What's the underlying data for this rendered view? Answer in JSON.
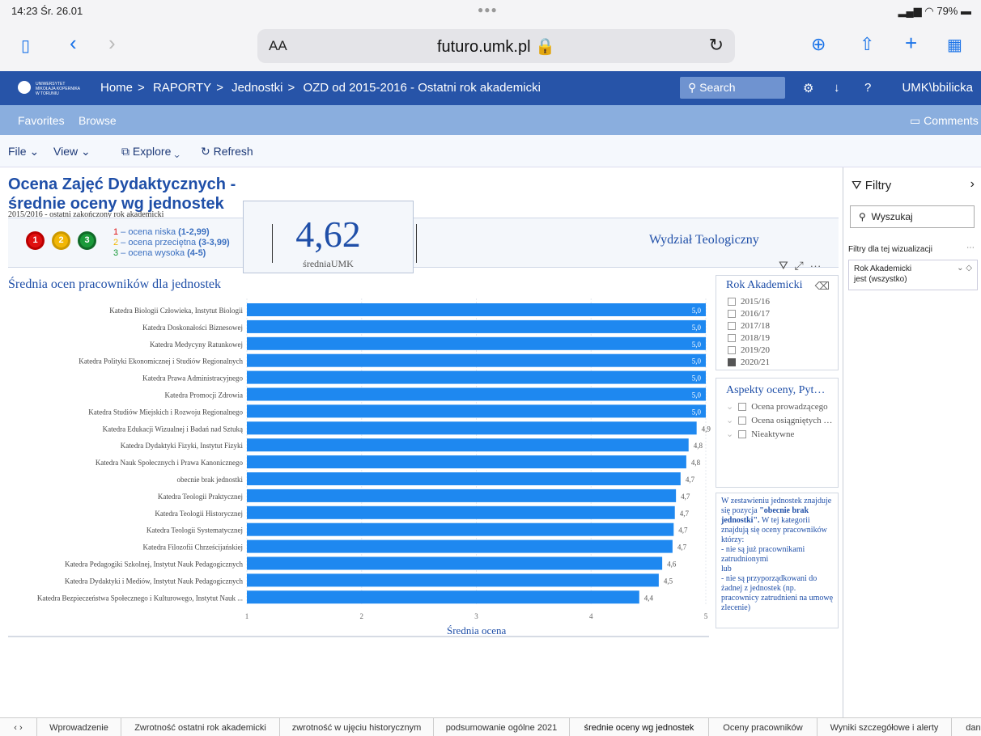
{
  "statusbar": {
    "time": "14:23  Śr. 26.01",
    "battery": "79%"
  },
  "safari": {
    "url": "futuro.umk.pl",
    "aa": "AA"
  },
  "header": {
    "logo_text": "UNIWERSYTET MIKOŁAJA KOPERNIKA W TORUNIU",
    "breadcrumb": [
      "Home",
      "RAPORTY",
      "Jednostki",
      "OZD od 2015-2016 - Ostatni rok akademicki"
    ],
    "search_label": "Search",
    "help": "?",
    "user": "UMK\\bbilicka"
  },
  "nav": {
    "favorites": "Favorites",
    "browse": "Browse",
    "comments": "Comments"
  },
  "toolbar": {
    "file": "File",
    "view": "View",
    "explore": "Explore",
    "refresh": "Refresh"
  },
  "report": {
    "title_line1": "Ocena Zajęć Dydaktycznych -",
    "title_line2": "średnie oceny wg jednostek",
    "subtitle": "2015/2016 - ostatni zakończony rok akademicki",
    "legend": [
      {
        "num": "1",
        "text": " – ocena niska ",
        "range": "(1-2,99)",
        "color": "#e01010"
      },
      {
        "num": "2",
        "text": " – ocena przeciętna ",
        "range": "(3-3,99)",
        "color": "#f2b705"
      },
      {
        "num": "3",
        "text": " – ocena wysoka ",
        "range": "(4-5)",
        "color": "#1a9a3a"
      }
    ],
    "kpi_value": "4,62",
    "kpi_label": "średniaUMK",
    "faculty": "Wydział Teologiczny"
  },
  "chart_data": {
    "type": "bar",
    "orientation": "horizontal",
    "title": "Średnia ocen pracowników dla jednostek",
    "xlabel": "Średnia ocena",
    "xlim": [
      1,
      5
    ],
    "xticks": [
      "1",
      "2",
      "3",
      "4",
      "5"
    ],
    "categories": [
      "Katedra Biologii Człowieka, Instytut Biologii",
      "Katedra Doskonałości Biznesowej",
      "Katedra Medycyny Ratunkowej",
      "Katedra Polityki Ekonomicznej i Studiów Regionalnych",
      "Katedra Prawa Administracyjnego",
      "Katedra Promocji Zdrowia",
      "Katedra Studiów Miejskich i Rozwoju Regionalnego",
      "Katedra Edukacji Wizualnej i Badań nad Sztuką",
      "Katedra Dydaktyki Fizyki, Instytut Fizyki",
      "Katedra Nauk Społecznych i Prawa Kanonicznego",
      "obecnie brak jednostki",
      "Katedra Teologii Praktycznej",
      "Katedra Teologii Historycznej",
      "Katedra Teologii Systematycznej",
      "Katedra Filozofii Chrześcijańskiej",
      "Katedra Pedagogiki Szkolnej, Instytut Nauk Pedagogicznych",
      "Katedra Dydaktyki i Mediów, Instytut Nauk Pedagogicznych",
      "Katedra Bezpieczeństwa Społecznego i Kulturowego, Instytut Nauk ..."
    ],
    "values": [
      5.0,
      5.0,
      5.0,
      5.0,
      5.0,
      5.0,
      5.0,
      4.92,
      4.85,
      4.83,
      4.78,
      4.74,
      4.73,
      4.72,
      4.71,
      4.62,
      4.59,
      4.42
    ],
    "value_labels": [
      "5,0",
      "5,0",
      "5,0",
      "5,0",
      "5,0",
      "5,0",
      "5,0",
      "4,9",
      "4,8",
      "4,8",
      "4,7",
      "4,7",
      "4,7",
      "4,7",
      "4,7",
      "4,6",
      "4,5",
      "4,4"
    ],
    "bar_color": "#1e88f0"
  },
  "slicer_year": {
    "title": "Rok Akademicki",
    "items": [
      {
        "label": "2015/16",
        "checked": false
      },
      {
        "label": "2016/17",
        "checked": false
      },
      {
        "label": "2017/18",
        "checked": false
      },
      {
        "label": "2018/19",
        "checked": false
      },
      {
        "label": "2019/20",
        "checked": false
      },
      {
        "label": "2020/21",
        "checked": true
      }
    ]
  },
  "slicer_aspects": {
    "title": "Aspekty oceny, Pyt…",
    "items": [
      "Ocena prowadzącego",
      "Ocena osiągniętych …",
      "Nieaktywne"
    ]
  },
  "note": {
    "intro": "W zestawieniu jednostek znajduje się pozycja ",
    "bold": "\"obecnie brak jednostki\".",
    "rest": " W tej kategorii znajdują się oceny pracowników którzy:",
    "line1": "- nie są już pracownikami zatrudnionymi",
    "lub": "lub",
    "line2": "- nie są przyporządkowani do żadnej z jednostek (np. pracownicy zatrudnieni na umowę zlecenie)"
  },
  "filters": {
    "title": "Filtry",
    "search_placeholder": "Wyszukaj",
    "section_label": "Filtry dla tej wizualizacji",
    "card_title": "Rok Akademicki",
    "card_value": "jest (wszystko)"
  },
  "tabs": [
    "Wprowadzenie",
    "Zwrotność ostatni rok akademicki",
    "zwrotność w ujęciu historycznym",
    "podsumowanie ogólne 2021",
    "średnie oceny wg jednostek",
    "Oceny pracowników",
    "Wyniki szczegółowe i alerty",
    "dane"
  ],
  "active_tab": 4
}
